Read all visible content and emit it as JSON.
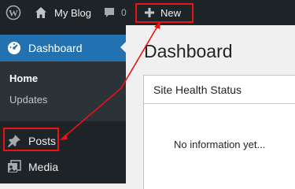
{
  "admin_bar": {
    "logo_icon": "wordpress-logo-icon",
    "site_name": "My Blog",
    "site_icon": "home-icon",
    "comments_icon": "comment-bubble-icon",
    "comments_count": "0",
    "new_icon": "plus-icon",
    "new_label": "New"
  },
  "sidebar": {
    "dashboard": {
      "label": "Dashboard",
      "icon": "gauge-icon"
    },
    "submenu": [
      {
        "label": "Home"
      },
      {
        "label": "Updates"
      }
    ],
    "items": [
      {
        "label": "Posts",
        "icon": "pin-icon"
      },
      {
        "label": "Media",
        "icon": "media-icon"
      }
    ]
  },
  "main": {
    "title": "Dashboard",
    "widget": {
      "title": "Site Health Status",
      "body": "No information yet..."
    }
  },
  "colors": {
    "admin_bar_bg": "#1d2327",
    "accent": "#2271b1",
    "annotation": "#e11111"
  }
}
